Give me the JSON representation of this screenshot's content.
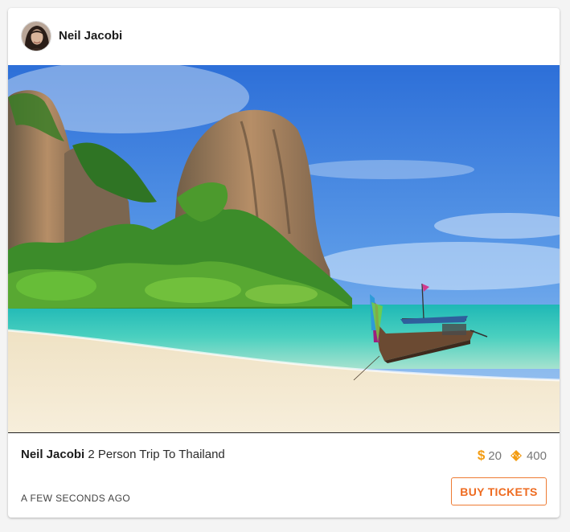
{
  "post": {
    "author_name": "Neil Jacobi",
    "photo_icon": "tropical-beach-photo",
    "caption_author": "Neil Jacobi",
    "caption_text": "2 Person Trip To Thailand",
    "price": "20",
    "price_icon": "dollar-icon",
    "tickets": "400",
    "tickets_icon": "ticket-icon",
    "timestamp": "A FEW SECONDS AGO",
    "buy_label": "BUY TICKETS"
  },
  "colors": {
    "accent": "#ee6b20",
    "dollar": "#f39c12"
  }
}
